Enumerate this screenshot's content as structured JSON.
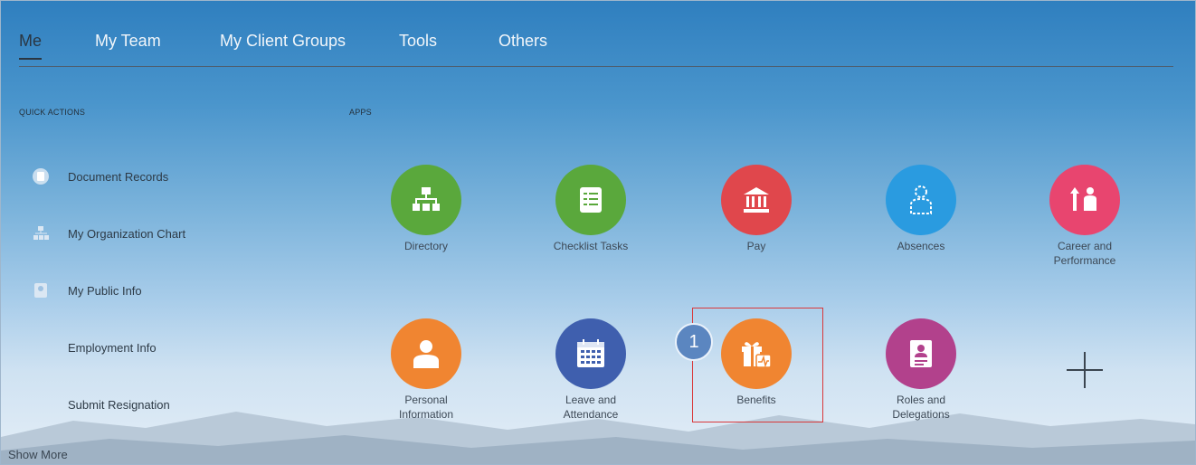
{
  "nav": {
    "items": [
      "Me",
      "My Team",
      "My Client Groups",
      "Tools",
      "Others"
    ]
  },
  "quick_actions": {
    "heading": "QUICK ACTIONS",
    "items": [
      "Document Records",
      "My Organization Chart",
      "My Public Info",
      "Employment Info",
      "Submit Resignation"
    ],
    "show_more": "Show More"
  },
  "apps": {
    "heading": "APPS",
    "items": [
      {
        "label": "Directory",
        "icon": "org-chart-icon",
        "color": "#5aa83c"
      },
      {
        "label": "Checklist Tasks",
        "icon": "checklist-icon",
        "color": "#5aa83c"
      },
      {
        "label": "Pay",
        "icon": "bank-icon",
        "color": "#e0474c"
      },
      {
        "label": "Absences",
        "icon": "person-outline-icon",
        "color": "#2a9be0"
      },
      {
        "label": "Career and\nPerformance",
        "icon": "career-people-icon",
        "color": "#e8456f"
      },
      {
        "label": "Personal\nInformation",
        "icon": "person-icon",
        "color": "#f08531"
      },
      {
        "label": "Leave and\nAttendance",
        "icon": "calendar-icon",
        "color": "#3f5fae"
      },
      {
        "label": "Benefits",
        "icon": "gift-icon",
        "color": "#f08531"
      },
      {
        "label": "Roles and\nDelegations",
        "icon": "badge-icon",
        "color": "#b2418c"
      }
    ]
  },
  "annotation": {
    "step": "1"
  }
}
